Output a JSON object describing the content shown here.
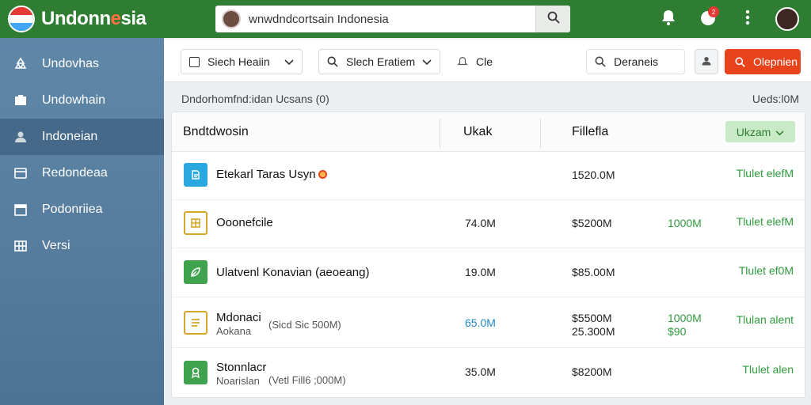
{
  "header": {
    "brand_main": "Undonn",
    "brand_hl": "e",
    "brand_tail": "sia",
    "search_value": "wnwdndcortsain Indonesia",
    "notif_count": "2"
  },
  "sidebar": {
    "items": [
      {
        "label": "Undovhas",
        "icon": "recycle-icon"
      },
      {
        "label": "Undowhain",
        "icon": "inbox-icon"
      },
      {
        "label": "Indoneian",
        "icon": "user-icon"
      },
      {
        "label": "Redondeaa",
        "icon": "card-icon"
      },
      {
        "label": "Podonriiea",
        "icon": "calendar-icon"
      },
      {
        "label": "Versi",
        "icon": "grid-icon"
      }
    ]
  },
  "toolbar": {
    "filter1": "Siech Heaiin",
    "filter2": "Slech Eratiem",
    "filter3": "Cle",
    "search_label": "Deraneis",
    "action": "Olepnien"
  },
  "summary": {
    "left": "Dndorhomfnd:idan Ucsans (0)",
    "right": "Ueds:l0M"
  },
  "table": {
    "headers": [
      "Bndtdwosin",
      "Ukak",
      "Fillefla"
    ],
    "upload_button": "Ukzam",
    "rows": [
      {
        "name": "Etekarl Taras Usyn",
        "c2": "",
        "c3": "1520.0M",
        "c3b": "",
        "c4": "",
        "c4b": "",
        "action": "Tlulet elefM",
        "icon_color": "#29a8e0",
        "icon": "doc-icon"
      },
      {
        "name": "Ooonefcile",
        "c2": "74.0M",
        "c3": "$5200M",
        "c3b": "",
        "c4": "1000M",
        "c4b": "",
        "action": "Tlulet elefM",
        "icon_color": "#d4a72c",
        "icon": "grid-icon"
      },
      {
        "name": "Ulatvenl Konavian (aeoeang)",
        "c2": "19.0M",
        "c3": "$85.00M",
        "c3b": "",
        "c4": "",
        "c4b": "",
        "action": "Tlulet ef0M",
        "icon_color": "#3fa34d",
        "icon": "leaf-icon"
      },
      {
        "name": "Mdonaci",
        "sub": "Aokana",
        "note": "(Sicd Sic 500M)",
        "c2": "65.0M",
        "c3": "$5500M",
        "c3b": "25.300M",
        "c4": "1000M",
        "c4b": "$90",
        "action": "Tlulan alent",
        "icon_color": "#d4a72c",
        "icon": "list-icon"
      },
      {
        "name": "Stonnlacr",
        "sub": "Noarislan",
        "note": "(Vetl Fill6 ;000M)",
        "c2": "35.0M",
        "c3": "$8200M",
        "c3b": "",
        "c4": "",
        "c4b": "",
        "action": "Tlulet alen",
        "icon_color": "#3fa34d",
        "icon": "badge-icon"
      }
    ]
  }
}
